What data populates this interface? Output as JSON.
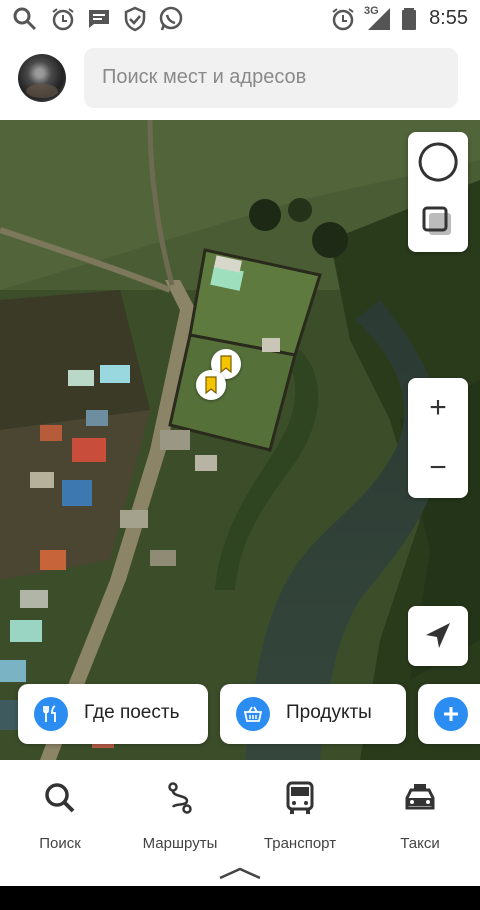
{
  "status_bar": {
    "time": "8:55",
    "network": "3G",
    "left_icons": [
      "search-icon",
      "alarm-icon",
      "message-icon",
      "shield-icon",
      "whatsapp-icon"
    ],
    "right_icons": [
      "alarm-icon",
      "signal-icon",
      "battery-icon"
    ]
  },
  "search": {
    "placeholder": "Поиск мест и адресов"
  },
  "map_controls": {
    "layers_icons": [
      "circle-layer-icon",
      "square-layer-icon"
    ],
    "zoom_in": "+",
    "zoom_out": "−",
    "locate_icon": "location-arrow-icon"
  },
  "chips": [
    {
      "label": "Где поесть",
      "icon": "fork-knife-icon"
    },
    {
      "label": "Продукты",
      "icon": "basket-icon"
    },
    {
      "label": "",
      "icon": "plus-icon"
    }
  ],
  "bottom_nav": [
    {
      "label": "Поиск",
      "icon": "search-icon"
    },
    {
      "label": "Маршруты",
      "icon": "route-icon"
    },
    {
      "label": "Транспорт",
      "icon": "bus-icon"
    },
    {
      "label": "Такси",
      "icon": "taxi-icon"
    }
  ],
  "colors": {
    "accent": "#2b8cf2",
    "bookmark_marker": "#f5c400"
  }
}
